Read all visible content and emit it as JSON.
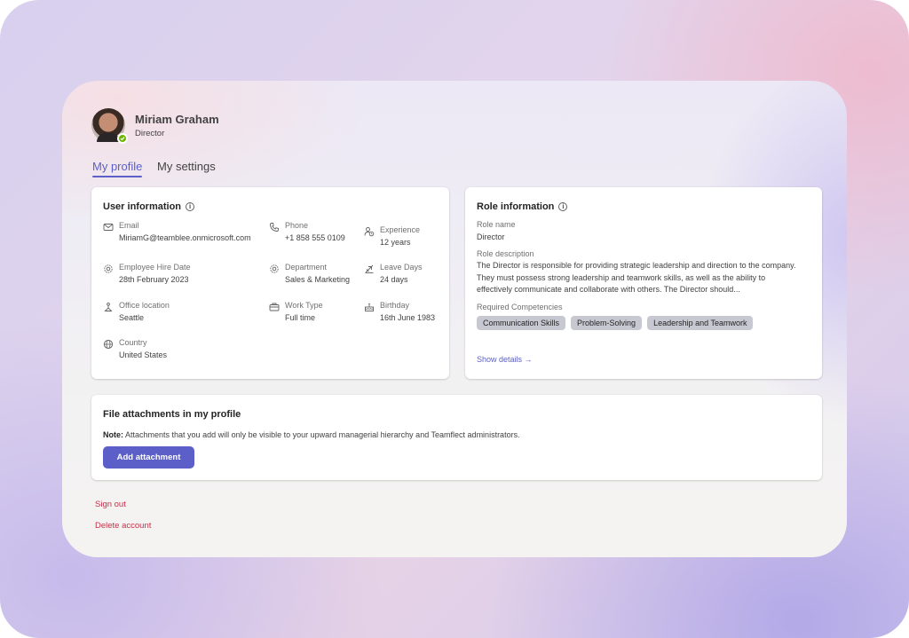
{
  "profile": {
    "name": "Miriam Graham",
    "title": "Director",
    "status_color": "#6bb700"
  },
  "tabs": [
    {
      "label": "My profile",
      "active": true
    },
    {
      "label": "My settings",
      "active": false
    }
  ],
  "user_info": {
    "heading": "User information",
    "fields": [
      {
        "label": "Email",
        "value": "MiriamG@teamblee.onmicrosoft.com",
        "icon": "mail-icon"
      },
      {
        "label": "Phone",
        "value": "+1 858 555 0109",
        "icon": "phone-icon"
      },
      {
        "label": "Experience",
        "value": "12 years",
        "icon": "person-clock-icon"
      },
      {
        "label": "Employee Hire Date",
        "value": "28th February 2023",
        "icon": "gear-icon"
      },
      {
        "label": "Department",
        "value": "Sales & Marketing",
        "icon": "gear-icon"
      },
      {
        "label": "Leave Days",
        "value": "24 days",
        "icon": "airplane-icon"
      },
      {
        "label": "Office location",
        "value": "Seattle",
        "icon": "location-icon"
      },
      {
        "label": "Work Type",
        "value": "Full time",
        "icon": "briefcase-icon"
      },
      {
        "label": "Birthday",
        "value": "16th June 1983",
        "icon": "cake-icon"
      },
      {
        "label": "Country",
        "value": "United States",
        "icon": "globe-icon"
      }
    ]
  },
  "role_info": {
    "heading": "Role information",
    "role_name_label": "Role name",
    "role_name": "Director",
    "description_label": "Role description",
    "description": "The Director is responsible for providing strategic leadership and direction to the company. They must possess strong leadership and teamwork skills, as well as the ability to effectively communicate and collaborate with others. The Director should...",
    "competencies_label": "Required Competencies",
    "competencies": [
      "Communication Skills",
      "Problem-Solving",
      "Leadership and Teamwork"
    ],
    "show_details": "Show details →"
  },
  "files": {
    "heading": "File attachments in my profile",
    "note_label": "Note:",
    "note_text": "Attachments that you add will only be visible to your upward managerial hierarchy and Teamflect administrators.",
    "add_button": "Add attachment"
  },
  "actions": {
    "sign_out": "Sign out",
    "delete_account": "Delete account"
  },
  "colors": {
    "accent": "#5b5fc7",
    "danger": "#c4314b"
  }
}
